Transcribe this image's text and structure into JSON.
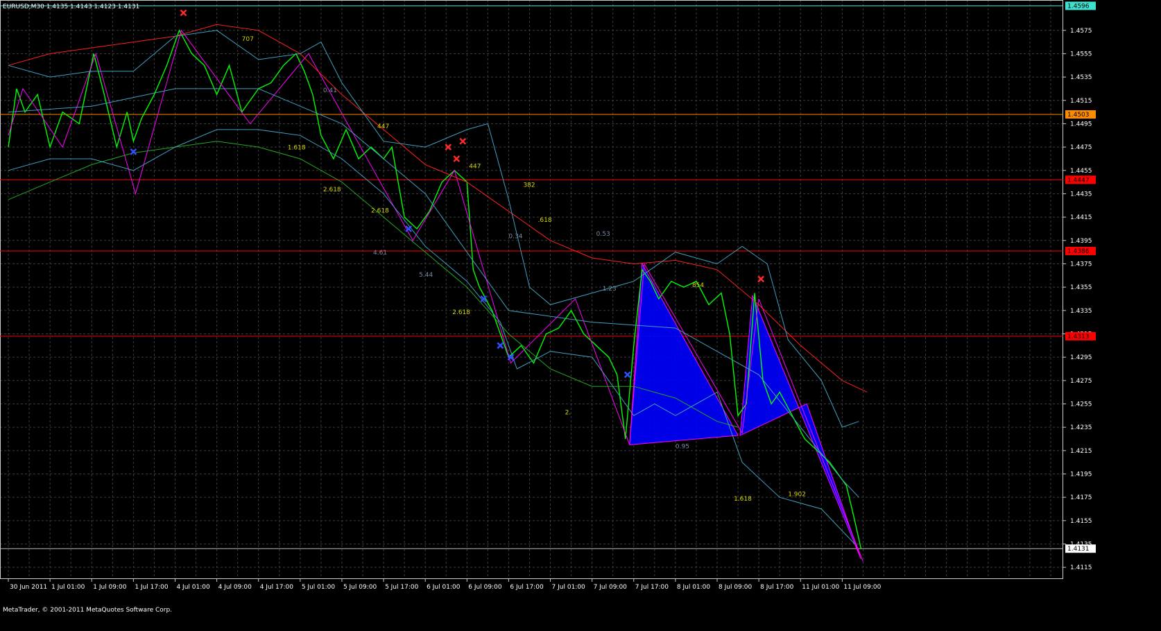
{
  "header": {
    "symbol_info": "EURUSD,M30  1.4135 1.4143 1.4123 1.4131"
  },
  "footer": {
    "copyright": "MetaTrader, © 2001-2011 MetaQuotes Software Corp."
  },
  "colors": {
    "background": "#000000",
    "grid": "#3c3c3c",
    "price": "#00ff00",
    "zigzag": "#ff00ff",
    "upper_band": "#ff2020",
    "lower_band": "#22aa22",
    "bollinger": "#40a0c0",
    "pattern_fill": "#0000ff",
    "hline_red": "#ff0000",
    "hline_orange": "#ff8c00",
    "tag_cyan": "#40e0d0",
    "current_line": "#b8b8b8"
  },
  "chart_data": {
    "type": "line",
    "title": "EURUSD,M30",
    "ylim": [
      1.4105,
      1.4601
    ],
    "y_ticks": [
      "1.4575",
      "1.4555",
      "1.4535",
      "1.4515",
      "1.4495",
      "1.4475",
      "1.4455",
      "1.4435",
      "1.4415",
      "1.4395",
      "1.4375",
      "1.4355",
      "1.4335",
      "1.4315",
      "1.4295",
      "1.4275",
      "1.4255",
      "1.4235",
      "1.4215",
      "1.4195",
      "1.4175",
      "1.4155",
      "1.4135",
      "1.4115"
    ],
    "x_ticks": [
      "30 Jun 2011",
      "1 Jul 01:00",
      "1 Jul 09:00",
      "1 Jul 17:00",
      "4 Jul 01:00",
      "4 Jul 09:00",
      "4 Jul 17:00",
      "5 Jul 01:00",
      "5 Jul 09:00",
      "5 Jul 17:00",
      "6 Jul 01:00",
      "6 Jul 09:00",
      "6 Jul 17:00",
      "7 Jul 01:00",
      "7 Jul 09:00",
      "7 Jul 17:00",
      "8 Jul 01:00",
      "8 Jul 09:00",
      "8 Jul 17:00",
      "11 Jul 01:00",
      "11 Jul 09:00"
    ],
    "x_tick_pos": [
      0,
      1,
      2,
      3,
      4,
      5,
      6,
      7,
      8,
      9,
      10,
      11,
      12,
      13,
      14,
      15,
      16,
      17,
      18,
      19,
      20
    ],
    "x_range": [
      0,
      25.3
    ],
    "price_levels": [
      {
        "label": "1.4596",
        "price": 1.4596,
        "color": "#40e0d0",
        "tag_bg": "#40e0d0"
      },
      {
        "label": "1.4503",
        "price": 1.4503,
        "color": "#ff8c00",
        "tag_bg": "#ff8c00"
      },
      {
        "label": "1.4447",
        "price": 1.4447,
        "color": "#ff0000",
        "tag_bg": "#ff0000"
      },
      {
        "label": "1.4386",
        "price": 1.4386,
        "color": "#ff0000",
        "tag_bg": "#ff0000"
      },
      {
        "label": "1.4313",
        "price": 1.4313,
        "color": "#ff0000",
        "tag_bg": "#ff0000"
      },
      {
        "label": "1.4131",
        "price": 1.4131,
        "color": "#b8b8b8",
        "tag_bg": "#ffffff"
      }
    ],
    "series": [
      {
        "name": "Price",
        "color": "#00ff00",
        "points": [
          [
            0,
            1.4475
          ],
          [
            0.2,
            1.4525
          ],
          [
            0.4,
            1.4505
          ],
          [
            0.7,
            1.452
          ],
          [
            1.0,
            1.4475
          ],
          [
            1.3,
            1.4505
          ],
          [
            1.7,
            1.4495
          ],
          [
            2.05,
            1.4555
          ],
          [
            2.3,
            1.452
          ],
          [
            2.6,
            1.4475
          ],
          [
            2.85,
            1.4505
          ],
          [
            3.0,
            1.448
          ],
          [
            3.2,
            1.45
          ],
          [
            3.5,
            1.452
          ],
          [
            3.8,
            1.4545
          ],
          [
            4.1,
            1.4575
          ],
          [
            4.4,
            1.4555
          ],
          [
            4.7,
            1.4545
          ],
          [
            5.0,
            1.452
          ],
          [
            5.3,
            1.4545
          ],
          [
            5.6,
            1.4505
          ],
          [
            6.0,
            1.4525
          ],
          [
            6.3,
            1.453
          ],
          [
            6.6,
            1.4545
          ],
          [
            6.9,
            1.4555
          ],
          [
            7.1,
            1.454
          ],
          [
            7.3,
            1.452
          ],
          [
            7.5,
            1.4485
          ],
          [
            7.8,
            1.4465
          ],
          [
            8.1,
            1.449
          ],
          [
            8.4,
            1.4465
          ],
          [
            8.7,
            1.4475
          ],
          [
            9.0,
            1.4465
          ],
          [
            9.2,
            1.4475
          ],
          [
            9.5,
            1.4415
          ],
          [
            9.8,
            1.4405
          ],
          [
            10.1,
            1.442
          ],
          [
            10.4,
            1.4445
          ],
          [
            10.7,
            1.4455
          ],
          [
            11.0,
            1.4445
          ],
          [
            11.15,
            1.437
          ],
          [
            11.3,
            1.4355
          ],
          [
            11.6,
            1.4335
          ],
          [
            11.8,
            1.4315
          ],
          [
            12.0,
            1.4295
          ],
          [
            12.3,
            1.4305
          ],
          [
            12.6,
            1.429
          ],
          [
            12.9,
            1.4315
          ],
          [
            13.2,
            1.432
          ],
          [
            13.5,
            1.4335
          ],
          [
            13.8,
            1.4315
          ],
          [
            14.1,
            1.4305
          ],
          [
            14.4,
            1.4295
          ],
          [
            14.6,
            1.428
          ],
          [
            14.8,
            1.4225
          ],
          [
            15.0,
            1.4305
          ],
          [
            15.2,
            1.437
          ],
          [
            15.4,
            1.436
          ],
          [
            15.6,
            1.4345
          ],
          [
            15.9,
            1.436
          ],
          [
            16.2,
            1.4355
          ],
          [
            16.5,
            1.436
          ],
          [
            16.8,
            1.434
          ],
          [
            17.1,
            1.435
          ],
          [
            17.3,
            1.4315
          ],
          [
            17.5,
            1.4245
          ],
          [
            17.7,
            1.4255
          ],
          [
            17.9,
            1.435
          ],
          [
            18.1,
            1.4275
          ],
          [
            18.3,
            1.4255
          ],
          [
            18.5,
            1.4265
          ],
          [
            18.8,
            1.4245
          ],
          [
            19.1,
            1.4225
          ],
          [
            19.4,
            1.4215
          ],
          [
            19.7,
            1.4205
          ],
          [
            19.9,
            1.4195
          ],
          [
            20.1,
            1.4185
          ],
          [
            20.3,
            1.4155
          ],
          [
            20.45,
            1.4131
          ]
        ]
      },
      {
        "name": "ZigZag",
        "color": "#ff00ff",
        "points": [
          [
            0,
            1.4485
          ],
          [
            0.35,
            1.4525
          ],
          [
            1.3,
            1.4475
          ],
          [
            2.1,
            1.4555
          ],
          [
            3.05,
            1.4435
          ],
          [
            4.15,
            1.4575
          ],
          [
            5.8,
            1.4495
          ],
          [
            7.2,
            1.4555
          ],
          [
            9.7,
            1.4395
          ],
          [
            10.7,
            1.4455
          ],
          [
            12.05,
            1.429
          ],
          [
            13.6,
            1.4345
          ],
          [
            14.9,
            1.422
          ],
          [
            15.25,
            1.4375
          ],
          [
            17.6,
            1.423
          ],
          [
            18.0,
            1.4345
          ],
          [
            20.5,
            1.412
          ]
        ]
      },
      {
        "name": "UpperEnvelope",
        "color": "#ff2020",
        "points": [
          [
            0,
            1.4545
          ],
          [
            1,
            1.4555
          ],
          [
            2,
            1.456
          ],
          [
            3,
            1.4565
          ],
          [
            4,
            1.457
          ],
          [
            5,
            1.458
          ],
          [
            6,
            1.4575
          ],
          [
            7,
            1.4555
          ],
          [
            8,
            1.452
          ],
          [
            9,
            1.449
          ],
          [
            10,
            1.446
          ],
          [
            11,
            1.4445
          ],
          [
            12,
            1.442
          ],
          [
            13,
            1.4395
          ],
          [
            14,
            1.438
          ],
          [
            15,
            1.4375
          ],
          [
            16,
            1.4378
          ],
          [
            17,
            1.437
          ],
          [
            18,
            1.434
          ],
          [
            19,
            1.4305
          ],
          [
            20,
            1.4275
          ],
          [
            20.6,
            1.4265
          ]
        ]
      },
      {
        "name": "LowerEnvelope",
        "color": "#22aa22",
        "points": [
          [
            0,
            1.443
          ],
          [
            1,
            1.4445
          ],
          [
            2,
            1.446
          ],
          [
            3,
            1.447
          ],
          [
            4,
            1.4475
          ],
          [
            5,
            1.448
          ],
          [
            6,
            1.4475
          ],
          [
            7,
            1.4465
          ],
          [
            8,
            1.4445
          ],
          [
            9,
            1.4415
          ],
          [
            10,
            1.4385
          ],
          [
            11,
            1.4355
          ],
          [
            12,
            1.4315
          ],
          [
            13,
            1.4285
          ],
          [
            14,
            1.427
          ],
          [
            15,
            1.427
          ],
          [
            16,
            1.426
          ],
          [
            17,
            1.424
          ],
          [
            17.5,
            1.4235
          ]
        ]
      },
      {
        "name": "BandUpper",
        "color": "#40a0c0",
        "points": [
          [
            0,
            1.4545
          ],
          [
            1,
            1.4535
          ],
          [
            2,
            1.454
          ],
          [
            3,
            1.454
          ],
          [
            4,
            1.457
          ],
          [
            5,
            1.4575
          ],
          [
            6,
            1.455
          ],
          [
            7,
            1.4555
          ],
          [
            7.5,
            1.4565
          ],
          [
            8,
            1.453
          ],
          [
            9,
            1.448
          ],
          [
            10,
            1.4475
          ],
          [
            11,
            1.449
          ],
          [
            11.5,
            1.4495
          ],
          [
            12,
            1.443
          ],
          [
            12.5,
            1.4355
          ],
          [
            13,
            1.434
          ],
          [
            14,
            1.435
          ],
          [
            15,
            1.436
          ],
          [
            16,
            1.4385
          ],
          [
            17,
            1.4375
          ],
          [
            17.6,
            1.439
          ],
          [
            18.2,
            1.4375
          ],
          [
            18.7,
            1.431
          ],
          [
            19.5,
            1.4275
          ],
          [
            20,
            1.4235
          ],
          [
            20.4,
            1.424
          ]
        ]
      },
      {
        "name": "BandLower",
        "color": "#40a0c0",
        "points": [
          [
            0,
            1.4455
          ],
          [
            1,
            1.4465
          ],
          [
            2,
            1.4465
          ],
          [
            3,
            1.4455
          ],
          [
            4,
            1.4475
          ],
          [
            5,
            1.449
          ],
          [
            6,
            1.449
          ],
          [
            7,
            1.4485
          ],
          [
            8,
            1.4465
          ],
          [
            9,
            1.4435
          ],
          [
            10,
            1.439
          ],
          [
            11,
            1.436
          ],
          [
            11.8,
            1.4325
          ],
          [
            12.2,
            1.4285
          ],
          [
            13,
            1.43
          ],
          [
            14,
            1.4295
          ],
          [
            15,
            1.4245
          ],
          [
            15.5,
            1.4255
          ],
          [
            16,
            1.4245
          ],
          [
            17,
            1.4265
          ],
          [
            17.6,
            1.4205
          ],
          [
            18.5,
            1.4175
          ],
          [
            19.5,
            1.4165
          ],
          [
            20.3,
            1.4135
          ]
        ]
      },
      {
        "name": "BandMiddle",
        "color": "#40a0c0",
        "points": [
          [
            0,
            1.4505
          ],
          [
            2,
            1.451
          ],
          [
            4,
            1.4525
          ],
          [
            6,
            1.4525
          ],
          [
            8,
            1.4495
          ],
          [
            10,
            1.4435
          ],
          [
            12,
            1.4335
          ],
          [
            14,
            1.4325
          ],
          [
            16,
            1.432
          ],
          [
            18,
            1.428
          ],
          [
            20,
            1.419
          ],
          [
            20.4,
            1.4175
          ]
        ]
      }
    ],
    "patterns": [
      {
        "points": [
          [
            14.9,
            1.422
          ],
          [
            15.2,
            1.4375
          ],
          [
            17.5,
            1.4228
          ]
        ],
        "color": "#0000ff"
      },
      {
        "points": [
          [
            17.55,
            1.4228
          ],
          [
            17.85,
            1.4348
          ],
          [
            20.45,
            1.4122
          ],
          [
            19.15,
            1.4255
          ]
        ],
        "color": "#0000ff"
      }
    ],
    "markers_red_x": [
      [
        4.2,
        1.459
      ],
      [
        10.55,
        1.4475
      ],
      [
        10.9,
        1.448
      ],
      [
        10.75,
        1.4465
      ],
      [
        18.05,
        1.4362
      ]
    ],
    "markers_blue_x": [
      [
        3.0,
        1.4471
      ],
      [
        9.6,
        1.4405
      ],
      [
        11.4,
        1.4345
      ],
      [
        11.8,
        1.4305
      ],
      [
        12.05,
        1.4295
      ],
      [
        14.85,
        1.428
      ]
    ],
    "fib_labels": [
      {
        "text": "707",
        "x": 5.6,
        "y": 1.4566,
        "color": "#d8d800"
      },
      {
        "text": "0.41",
        "x": 7.55,
        "y": 1.4522,
        "color": "#7a8aa8"
      },
      {
        "text": "447",
        "x": 8.85,
        "y": 1.4491,
        "color": "#d8d800"
      },
      {
        "text": "1.618",
        "x": 6.7,
        "y": 1.4473,
        "color": "#d8d800"
      },
      {
        "text": "447",
        "x": 11.05,
        "y": 1.4457,
        "color": "#d8d800"
      },
      {
        "text": "382",
        "x": 12.35,
        "y": 1.4441,
        "color": "#d8d800"
      },
      {
        "text": "2.618",
        "x": 7.55,
        "y": 1.4437,
        "color": "#d8d800"
      },
      {
        "text": "2.618",
        "x": 8.7,
        "y": 1.4419,
        "color": "#d8d800"
      },
      {
        "text": ".618",
        "x": 12.7,
        "y": 1.4411,
        "color": "#d8d800"
      },
      {
        "text": "0.53",
        "x": 14.1,
        "y": 1.4399,
        "color": "#7a8aa8"
      },
      {
        "text": "0.34",
        "x": 12.0,
        "y": 1.4397,
        "color": "#7a8aa8"
      },
      {
        "text": "4.61",
        "x": 8.75,
        "y": 1.4383,
        "color": "#7a8aa8"
      },
      {
        "text": "5.44",
        "x": 9.85,
        "y": 1.4364,
        "color": "#7a8aa8"
      },
      {
        "text": "1.23",
        "x": 14.25,
        "y": 1.4352,
        "color": "#7a8aa8"
      },
      {
        "text": "854",
        "x": 16.4,
        "y": 1.4355,
        "color": "#d8d800"
      },
      {
        "text": "2.618",
        "x": 10.65,
        "y": 1.4332,
        "color": "#d8d800"
      },
      {
        "text": "2.",
        "x": 13.35,
        "y": 1.4246,
        "color": "#d8d800"
      },
      {
        "text": "0.95",
        "x": 16.0,
        "y": 1.4217,
        "color": "#7a8aa8"
      },
      {
        "text": "1.902",
        "x": 18.7,
        "y": 1.4176,
        "color": "#d8d800"
      },
      {
        "text": "1.618",
        "x": 17.4,
        "y": 1.4172,
        "color": "#d8d800"
      }
    ]
  }
}
